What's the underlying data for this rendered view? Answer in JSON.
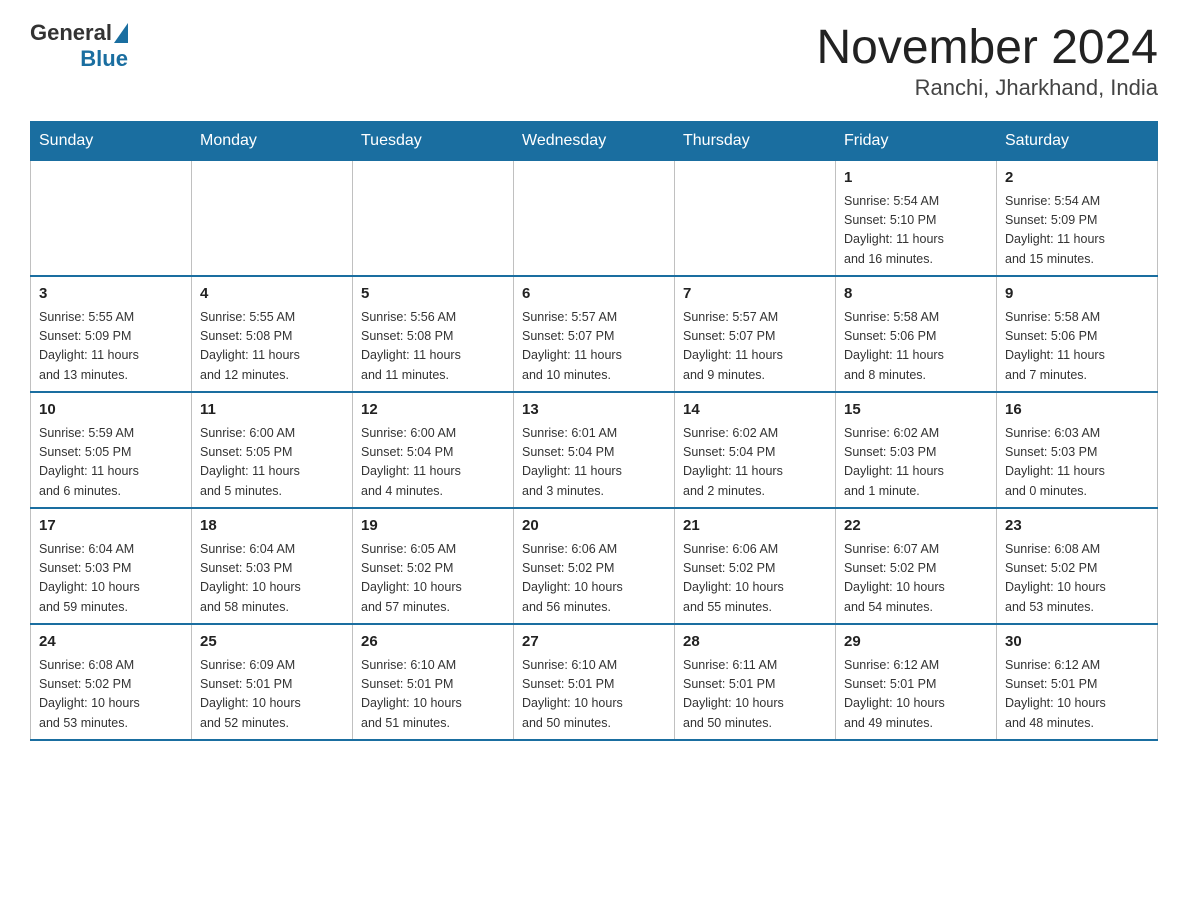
{
  "header": {
    "logo_general": "General",
    "logo_blue": "Blue",
    "title": "November 2024",
    "subtitle": "Ranchi, Jharkhand, India"
  },
  "weekdays": [
    "Sunday",
    "Monday",
    "Tuesday",
    "Wednesday",
    "Thursday",
    "Friday",
    "Saturday"
  ],
  "weeks": [
    {
      "days": [
        {
          "num": "",
          "info": ""
        },
        {
          "num": "",
          "info": ""
        },
        {
          "num": "",
          "info": ""
        },
        {
          "num": "",
          "info": ""
        },
        {
          "num": "",
          "info": ""
        },
        {
          "num": "1",
          "info": "Sunrise: 5:54 AM\nSunset: 5:10 PM\nDaylight: 11 hours\nand 16 minutes."
        },
        {
          "num": "2",
          "info": "Sunrise: 5:54 AM\nSunset: 5:09 PM\nDaylight: 11 hours\nand 15 minutes."
        }
      ]
    },
    {
      "days": [
        {
          "num": "3",
          "info": "Sunrise: 5:55 AM\nSunset: 5:09 PM\nDaylight: 11 hours\nand 13 minutes."
        },
        {
          "num": "4",
          "info": "Sunrise: 5:55 AM\nSunset: 5:08 PM\nDaylight: 11 hours\nand 12 minutes."
        },
        {
          "num": "5",
          "info": "Sunrise: 5:56 AM\nSunset: 5:08 PM\nDaylight: 11 hours\nand 11 minutes."
        },
        {
          "num": "6",
          "info": "Sunrise: 5:57 AM\nSunset: 5:07 PM\nDaylight: 11 hours\nand 10 minutes."
        },
        {
          "num": "7",
          "info": "Sunrise: 5:57 AM\nSunset: 5:07 PM\nDaylight: 11 hours\nand 9 minutes."
        },
        {
          "num": "8",
          "info": "Sunrise: 5:58 AM\nSunset: 5:06 PM\nDaylight: 11 hours\nand 8 minutes."
        },
        {
          "num": "9",
          "info": "Sunrise: 5:58 AM\nSunset: 5:06 PM\nDaylight: 11 hours\nand 7 minutes."
        }
      ]
    },
    {
      "days": [
        {
          "num": "10",
          "info": "Sunrise: 5:59 AM\nSunset: 5:05 PM\nDaylight: 11 hours\nand 6 minutes."
        },
        {
          "num": "11",
          "info": "Sunrise: 6:00 AM\nSunset: 5:05 PM\nDaylight: 11 hours\nand 5 minutes."
        },
        {
          "num": "12",
          "info": "Sunrise: 6:00 AM\nSunset: 5:04 PM\nDaylight: 11 hours\nand 4 minutes."
        },
        {
          "num": "13",
          "info": "Sunrise: 6:01 AM\nSunset: 5:04 PM\nDaylight: 11 hours\nand 3 minutes."
        },
        {
          "num": "14",
          "info": "Sunrise: 6:02 AM\nSunset: 5:04 PM\nDaylight: 11 hours\nand 2 minutes."
        },
        {
          "num": "15",
          "info": "Sunrise: 6:02 AM\nSunset: 5:03 PM\nDaylight: 11 hours\nand 1 minute."
        },
        {
          "num": "16",
          "info": "Sunrise: 6:03 AM\nSunset: 5:03 PM\nDaylight: 11 hours\nand 0 minutes."
        }
      ]
    },
    {
      "days": [
        {
          "num": "17",
          "info": "Sunrise: 6:04 AM\nSunset: 5:03 PM\nDaylight: 10 hours\nand 59 minutes."
        },
        {
          "num": "18",
          "info": "Sunrise: 6:04 AM\nSunset: 5:03 PM\nDaylight: 10 hours\nand 58 minutes."
        },
        {
          "num": "19",
          "info": "Sunrise: 6:05 AM\nSunset: 5:02 PM\nDaylight: 10 hours\nand 57 minutes."
        },
        {
          "num": "20",
          "info": "Sunrise: 6:06 AM\nSunset: 5:02 PM\nDaylight: 10 hours\nand 56 minutes."
        },
        {
          "num": "21",
          "info": "Sunrise: 6:06 AM\nSunset: 5:02 PM\nDaylight: 10 hours\nand 55 minutes."
        },
        {
          "num": "22",
          "info": "Sunrise: 6:07 AM\nSunset: 5:02 PM\nDaylight: 10 hours\nand 54 minutes."
        },
        {
          "num": "23",
          "info": "Sunrise: 6:08 AM\nSunset: 5:02 PM\nDaylight: 10 hours\nand 53 minutes."
        }
      ]
    },
    {
      "days": [
        {
          "num": "24",
          "info": "Sunrise: 6:08 AM\nSunset: 5:02 PM\nDaylight: 10 hours\nand 53 minutes."
        },
        {
          "num": "25",
          "info": "Sunrise: 6:09 AM\nSunset: 5:01 PM\nDaylight: 10 hours\nand 52 minutes."
        },
        {
          "num": "26",
          "info": "Sunrise: 6:10 AM\nSunset: 5:01 PM\nDaylight: 10 hours\nand 51 minutes."
        },
        {
          "num": "27",
          "info": "Sunrise: 6:10 AM\nSunset: 5:01 PM\nDaylight: 10 hours\nand 50 minutes."
        },
        {
          "num": "28",
          "info": "Sunrise: 6:11 AM\nSunset: 5:01 PM\nDaylight: 10 hours\nand 50 minutes."
        },
        {
          "num": "29",
          "info": "Sunrise: 6:12 AM\nSunset: 5:01 PM\nDaylight: 10 hours\nand 49 minutes."
        },
        {
          "num": "30",
          "info": "Sunrise: 6:12 AM\nSunset: 5:01 PM\nDaylight: 10 hours\nand 48 minutes."
        }
      ]
    }
  ]
}
